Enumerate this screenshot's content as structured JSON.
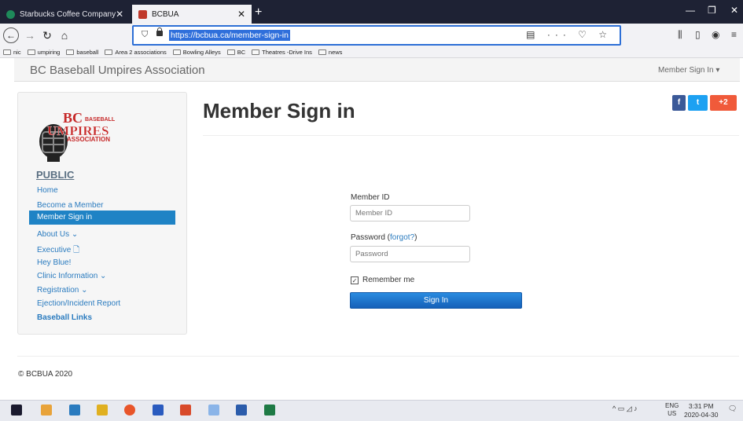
{
  "browser": {
    "tabs": [
      {
        "title": "Starbucks Coffee Company",
        "active": false
      },
      {
        "title": "BCBUA",
        "active": true
      }
    ],
    "url": "https://bcbua.ca/member-sign-in",
    "bookmarks": [
      "nic",
      "umpiring",
      "baseball",
      "Area 2 associations",
      "Bowling Alleys",
      "BC",
      "Theatres -Drive Ins",
      "news"
    ]
  },
  "site": {
    "title": "BC Baseball Umpires Association",
    "member_menu": "Member Sign In ▾",
    "logo_text": "BC BASEBALL UMPIRES ASSOCIATION"
  },
  "sidebar": {
    "heading": "PUBLIC",
    "items": [
      {
        "label": "Home"
      },
      {
        "label": "Become a Member"
      },
      {
        "label": "Member Sign in",
        "active": true
      },
      {
        "label": "About Us ⌄"
      },
      {
        "label": "Executive 🗋"
      },
      {
        "label": "Hey Blue!"
      },
      {
        "label": "Clinic Information ⌄"
      },
      {
        "label": "Registration ⌄"
      },
      {
        "label": "Ejection/Incident Report"
      },
      {
        "label": "Baseball Links"
      }
    ]
  },
  "main": {
    "title": "Member Sign in",
    "share": {
      "facebook": "f",
      "twitter": "t",
      "plus": "+2"
    },
    "form": {
      "member_id_label": "Member ID",
      "member_id_placeholder": "Member ID",
      "password_label": "Password",
      "forgot_label": "forgot?",
      "password_placeholder": "Password",
      "remember_label": "Remember me",
      "remember_checked": true,
      "signin_label": "Sign In"
    }
  },
  "footer": {
    "text": "© BCBUA 2020"
  },
  "taskbar": {
    "lang": "ENG",
    "region": "US",
    "time": "3:31 PM",
    "date": "2020-04-30"
  },
  "colors": {
    "accent": "#1f83c5",
    "link": "#2a7bbf",
    "facebook": "#3b5998",
    "twitter": "#1da1f2",
    "plus": "#f05a3a"
  }
}
